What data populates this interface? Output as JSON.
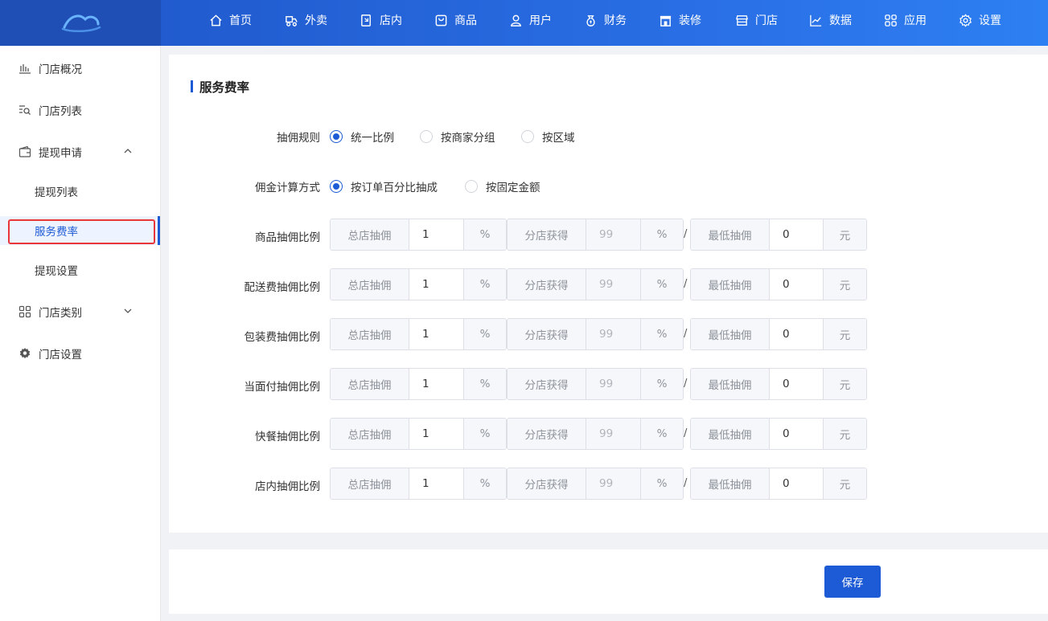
{
  "nav": {
    "items": [
      {
        "label": "首页",
        "icon": "home-icon"
      },
      {
        "label": "外卖",
        "icon": "delivery-icon"
      },
      {
        "label": "店内",
        "icon": "dine-in-icon"
      },
      {
        "label": "商品",
        "icon": "product-icon"
      },
      {
        "label": "用户",
        "icon": "user-icon"
      },
      {
        "label": "财务",
        "icon": "finance-icon"
      },
      {
        "label": "装修",
        "icon": "storefront-icon"
      },
      {
        "label": "门店",
        "icon": "store-icon"
      },
      {
        "label": "数据",
        "icon": "chart-icon"
      },
      {
        "label": "应用",
        "icon": "apps-icon"
      },
      {
        "label": "设置",
        "icon": "gear-icon"
      }
    ]
  },
  "sidebar": {
    "store_overview": "门店概况",
    "store_list": "门店列表",
    "withdraw_apply": "提现申请",
    "withdraw_list": "提现列表",
    "service_rate": "服务费率",
    "withdraw_settings": "提现设置",
    "store_category": "门店类别",
    "store_settings": "门店设置"
  },
  "page": {
    "title": "服务费率",
    "commission_rule_label": "抽佣规则",
    "commission_rule_options": [
      "统一比例",
      "按商家分组",
      "按区域"
    ],
    "commission_rule_selected": "统一比例",
    "calc_method_label": "佣金计算方式",
    "calc_method_options": [
      "按订单百分比抽成",
      "按固定金额"
    ],
    "calc_method_selected": "按订单百分比抽成",
    "addon_hq": "总店抽佣",
    "addon_branch": "分店获得",
    "addon_min": "最低抽佣",
    "unit_percent": "%",
    "unit_yuan": "元",
    "separator": "/",
    "rows": [
      {
        "label": "商品抽佣比例",
        "hq": "1",
        "branch": "99",
        "min": "0"
      },
      {
        "label": "配送费抽佣比例",
        "hq": "1",
        "branch": "99",
        "min": "0"
      },
      {
        "label": "包装费抽佣比例",
        "hq": "1",
        "branch": "99",
        "min": "0"
      },
      {
        "label": "当面付抽佣比例",
        "hq": "1",
        "branch": "99",
        "min": "0"
      },
      {
        "label": "快餐抽佣比例",
        "hq": "1",
        "branch": "99",
        "min": "0"
      },
      {
        "label": "店内抽佣比例",
        "hq": "1",
        "branch": "99",
        "min": "0"
      }
    ],
    "save_label": "保存"
  },
  "colors": {
    "primary": "#1d5ad5",
    "highlight_box": "#e8363b"
  }
}
